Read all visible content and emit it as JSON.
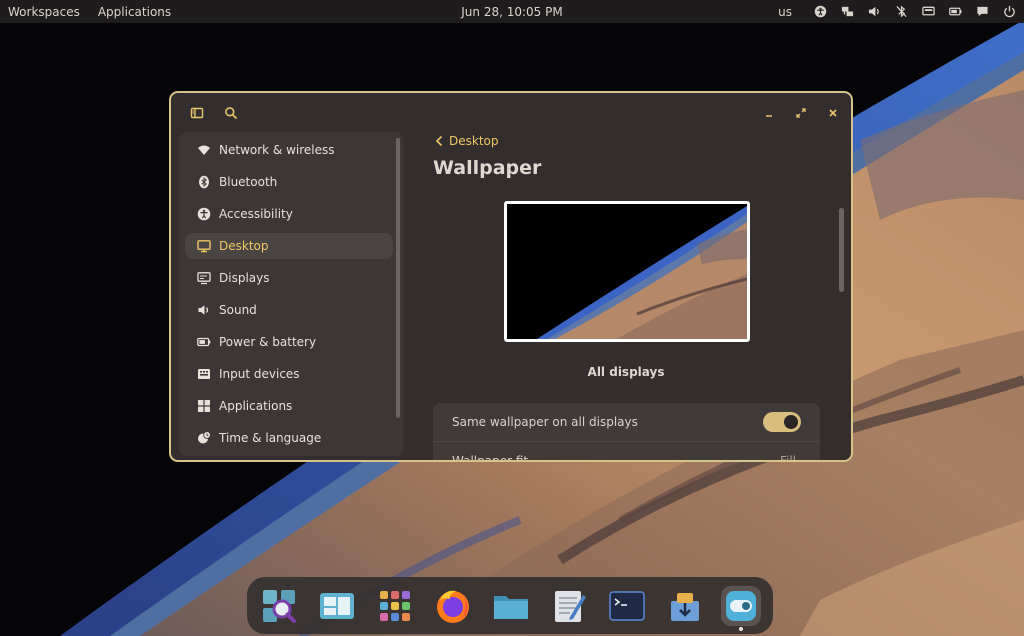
{
  "top_panel": {
    "workspaces": "Workspaces",
    "applications": "Applications",
    "clock": "Jun 28, 10:05 PM",
    "keyboard_layout": "us",
    "tray_icons": [
      "accessibility-icon",
      "network-icon",
      "volume-icon",
      "bluetooth-off-icon",
      "screen-icon",
      "battery-icon",
      "notifications-icon",
      "power-icon"
    ]
  },
  "window": {
    "header_icons": [
      "sidebar-toggle-icon",
      "search-icon"
    ],
    "controls": [
      "minimize-icon",
      "maximize-icon",
      "close-icon"
    ]
  },
  "sidebar": {
    "items": [
      {
        "label": "Network & wireless",
        "icon": "wifi-icon"
      },
      {
        "label": "Bluetooth",
        "icon": "bluetooth-icon"
      },
      {
        "label": "Accessibility",
        "icon": "accessibility-icon"
      },
      {
        "label": "Desktop",
        "icon": "desktop-icon",
        "active": true
      },
      {
        "label": "Displays",
        "icon": "displays-icon"
      },
      {
        "label": "Sound",
        "icon": "sound-icon"
      },
      {
        "label": "Power & battery",
        "icon": "power-battery-icon"
      },
      {
        "label": "Input devices",
        "icon": "keyboard-icon"
      },
      {
        "label": "Applications",
        "icon": "applications-icon"
      },
      {
        "label": "Time & language",
        "icon": "time-language-icon"
      }
    ]
  },
  "content": {
    "back_label": "Desktop",
    "title": "Wallpaper",
    "preview_label": "All displays",
    "rows": [
      {
        "label": "Same wallpaper on all displays",
        "toggle_on": true
      },
      {
        "label": "Wallpaper fit",
        "value": "Fill"
      }
    ]
  },
  "dock": {
    "apps": [
      "app-store-icon",
      "workspaces-icon",
      "app-library-icon",
      "firefox-icon",
      "files-icon",
      "text-editor-icon",
      "terminal-icon",
      "installer-icon",
      "settings-icon"
    ],
    "running": "settings-icon"
  },
  "colors": {
    "accent": "#f0c766",
    "window_border": "#d6c38a",
    "window_bg": "#332e2d",
    "panel_bg": "#1e1c1c"
  }
}
